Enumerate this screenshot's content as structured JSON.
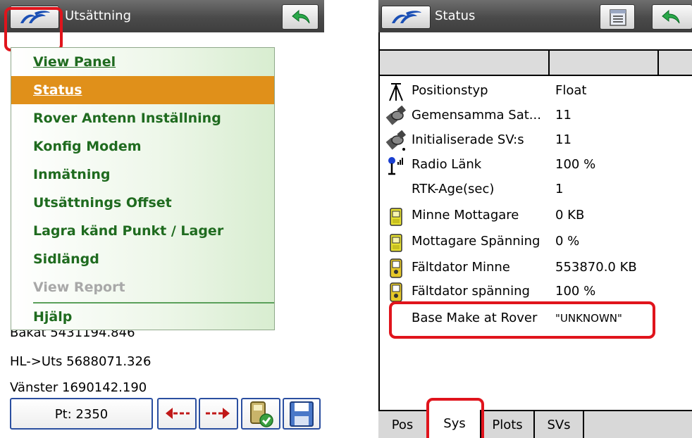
{
  "left": {
    "title": "Utsättning",
    "menu": [
      {
        "label": "View Panel",
        "state": "normal"
      },
      {
        "label": "Status",
        "state": "selected"
      },
      {
        "label": "Rover Antenn Inställning",
        "state": "normal"
      },
      {
        "label": "Konfig Modem",
        "state": "normal"
      },
      {
        "label": "Inmätning",
        "state": "normal"
      },
      {
        "label": "Utsättnings Offset",
        "state": "normal"
      },
      {
        "label": "Lagra känd Punkt / Lager",
        "state": "normal"
      },
      {
        "label": "Sidlängd",
        "state": "normal"
      },
      {
        "label": "View Report",
        "state": "disabled"
      },
      {
        "label": "Hjälp",
        "state": "normal"
      }
    ],
    "background_lines": {
      "bakat": "Bakåt 5431194.846",
      "hl_uts": "HL->Uts 5688071.326",
      "vanster": "Vänster 1690142.190"
    },
    "point_button": "Pt: 2350",
    "icons": {
      "app": "trimble-logo-icon",
      "back": "back-arrow-icon",
      "prev": "arrow-left-icon",
      "next": "arrow-right-icon",
      "gps": "gps-receiver-check-icon",
      "save": "floppy-disk-icon"
    }
  },
  "right": {
    "title": "Status",
    "rows": [
      {
        "label": "Positionstyp",
        "value": "Float",
        "icon": "survey-pole-icon"
      },
      {
        "label": "Gemensamma Sat...",
        "value": "11",
        "icon": "satellite-icon"
      },
      {
        "label": "Initialiserade SV:s",
        "value": "11",
        "icon": "satellite-sub-icon"
      },
      {
        "label": "Radio Länk",
        "value": "100 %",
        "icon": "radio-antenna-icon"
      },
      {
        "label": "RTK-Age(sec)",
        "value": "1",
        "icon": ""
      },
      {
        "label": "Minne Mottagare",
        "value": "0 KB",
        "icon": "receiver-memory-icon"
      },
      {
        "label": "Mottagare Spänning",
        "value": "0 %",
        "icon": "receiver-battery-icon"
      },
      {
        "label": "Fältdator Minne",
        "value": "553870.0 KB",
        "icon": "controller-memory-icon"
      },
      {
        "label": "Fältdator spänning",
        "value": "100 %",
        "icon": "controller-battery-icon"
      },
      {
        "label": "Base Make at Rover",
        "value": "\"UNKNOWN\"",
        "icon": ""
      }
    ],
    "tabs": [
      "Pos",
      "Sys",
      "Plots",
      "SVs"
    ],
    "active_tab": "Sys",
    "icons": {
      "app": "trimble-logo-icon",
      "view": "list-view-icon",
      "back": "back-arrow-icon"
    }
  },
  "colors": {
    "title_bar": "#4a4a4a",
    "menu_text": "#1f6b1f",
    "menu_selected": "#e0901a",
    "highlight": "#e0141c"
  }
}
